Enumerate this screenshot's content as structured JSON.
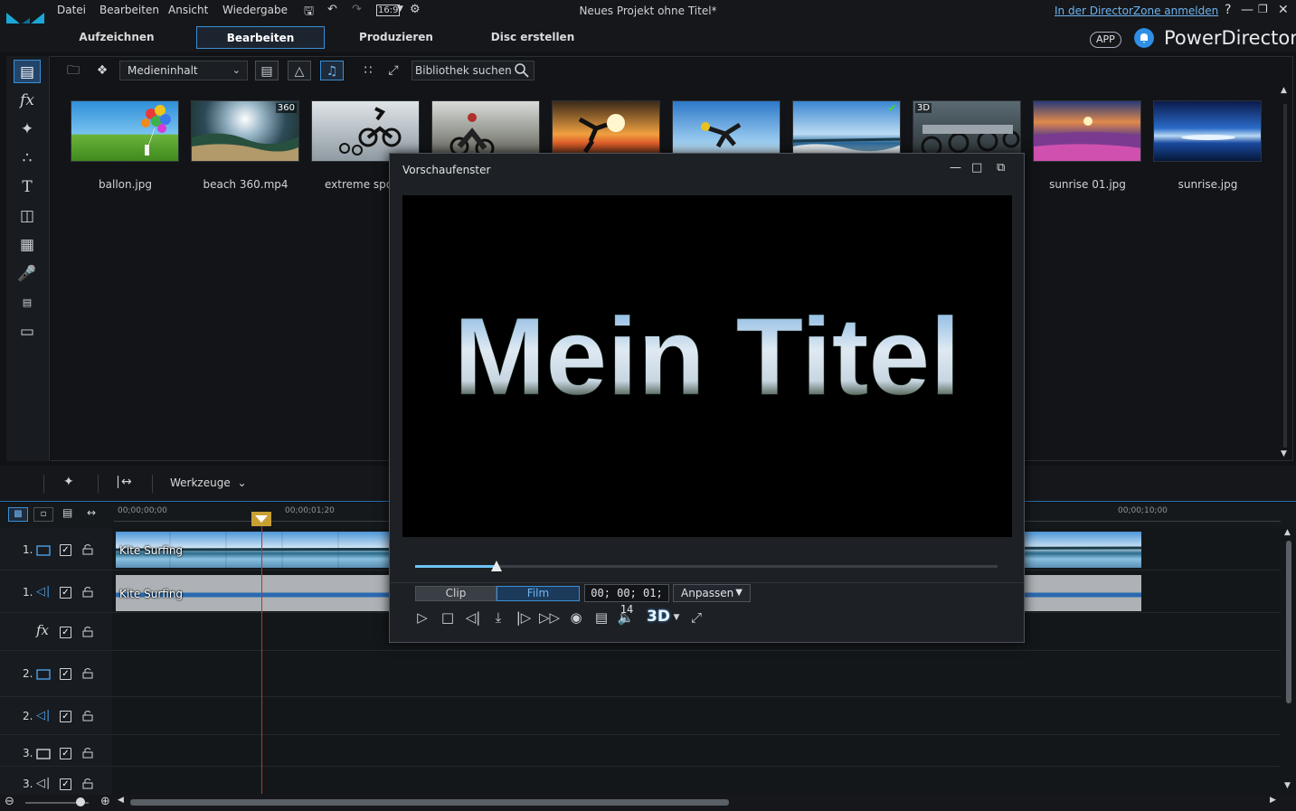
{
  "app": {
    "project_title": "Neues Projekt ohne Titel*",
    "directorzone_link": "In der DirectorZone anmelden",
    "app_badge": "APP",
    "product_name": "PowerDirector",
    "aspect_ratio": "16:9"
  },
  "menu": [
    "Datei",
    "Bearbeiten",
    "Ansicht",
    "Wiedergabe"
  ],
  "modes": [
    {
      "label": "Aufzeichnen",
      "active": false
    },
    {
      "label": "Bearbeiten",
      "active": true
    },
    {
      "label": "Produzieren",
      "active": false
    },
    {
      "label": "Disc erstellen",
      "active": false
    }
  ],
  "rail_icons": [
    "media-room-icon",
    "fx-room-icon",
    "pip-room-icon",
    "particle-room-icon",
    "title-room-icon",
    "transition-room-icon",
    "audio-mixing-icon",
    "voice-over-icon",
    "chapter-icon",
    "subtitle-icon"
  ],
  "library": {
    "content_dropdown": "Medieninhalt",
    "search_placeholder": "Bibliothek suchen",
    "items": [
      {
        "label": "ballon.jpg",
        "badge": ""
      },
      {
        "label": "beach 360.mp4",
        "badge": "360"
      },
      {
        "label": "extreme sports",
        "badge": ""
      },
      {
        "label": "",
        "badge": ""
      },
      {
        "label": "",
        "badge": ""
      },
      {
        "label": "",
        "badge": ""
      },
      {
        "label": "",
        "badge": "",
        "checked": true
      },
      {
        "label": "",
        "badge": "3D"
      },
      {
        "label": "sunrise 01.jpg",
        "badge": ""
      },
      {
        "label": "sunrise.jpg",
        "badge": ""
      }
    ]
  },
  "timeline": {
    "tools_label": "Werkzeuge",
    "ruler": [
      "00;00;00;00",
      "00;00;01;20",
      "00;00;10;00"
    ],
    "tracks": [
      {
        "num": "1.",
        "type": "video",
        "checked": true
      },
      {
        "num": "1.",
        "type": "audio",
        "checked": true
      },
      {
        "num": "",
        "type": "fx",
        "checked": true
      },
      {
        "num": "2.",
        "type": "video",
        "checked": true
      },
      {
        "num": "2.",
        "type": "audio",
        "checked": true
      },
      {
        "num": "3.",
        "type": "video",
        "checked": true
      },
      {
        "num": "3.",
        "type": "audio",
        "checked": true
      }
    ],
    "clip_video_label": "Kite Surfing",
    "clip_audio_label": "Kite Surfing"
  },
  "preview": {
    "window_title": "Vorschaufenster",
    "title_text": "Mein Titel",
    "mode_clip": "Clip",
    "mode_film": "Film",
    "timecode": "00; 00; 01; 14",
    "fit_label": "Anpassen",
    "three_d": "3D",
    "scrub_fraction": 0.14
  },
  "colors": {
    "accent": "#3b8fd6",
    "link": "#6fb4f0",
    "playhead": "#c0332b"
  }
}
